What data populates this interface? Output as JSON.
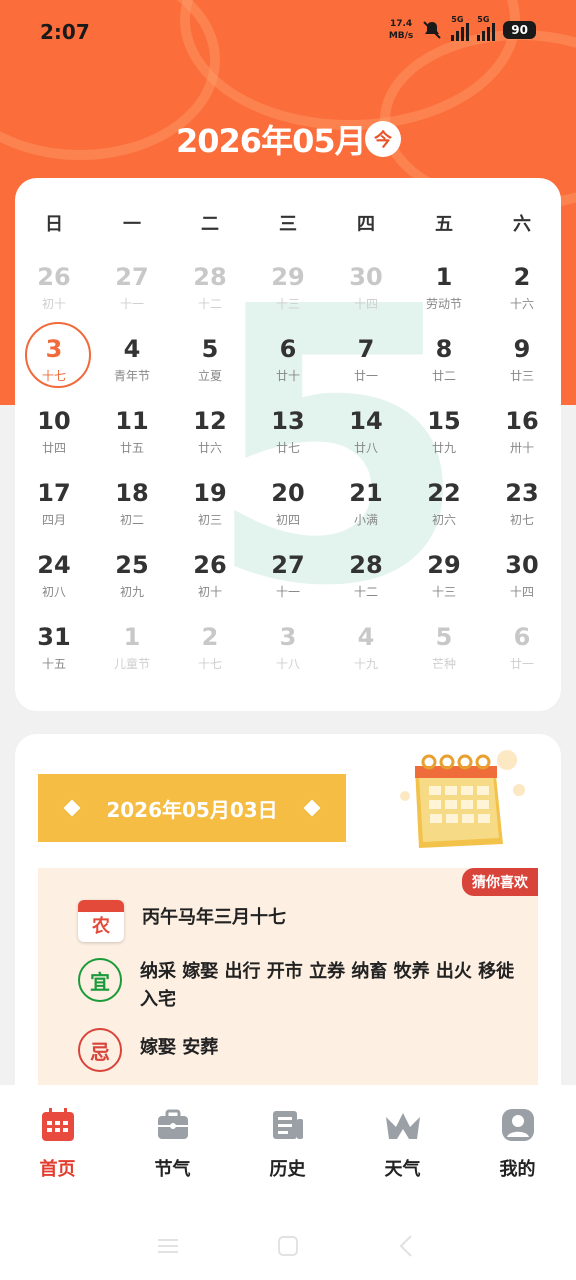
{
  "status": {
    "time": "2:07",
    "net_speed_value": "17.4",
    "net_speed_unit": "MB/s",
    "sim1": "5G",
    "sim2": "5G",
    "battery": "90"
  },
  "header": {
    "month_title": "2026年05月",
    "today_label": "今"
  },
  "calendar": {
    "big_number": "5",
    "weekdays": [
      "日",
      "一",
      "二",
      "三",
      "四",
      "五",
      "六"
    ],
    "rows": [
      [
        {
          "d": "26",
          "l": "初十",
          "other": true
        },
        {
          "d": "27",
          "l": "十一",
          "other": true
        },
        {
          "d": "28",
          "l": "十二",
          "other": true
        },
        {
          "d": "29",
          "l": "十三",
          "other": true
        },
        {
          "d": "30",
          "l": "十四",
          "other": true
        },
        {
          "d": "1",
          "l": "劳动节"
        },
        {
          "d": "2",
          "l": "十六"
        }
      ],
      [
        {
          "d": "3",
          "l": "十七",
          "today": true
        },
        {
          "d": "4",
          "l": "青年节"
        },
        {
          "d": "5",
          "l": "立夏"
        },
        {
          "d": "6",
          "l": "廿十"
        },
        {
          "d": "7",
          "l": "廿一"
        },
        {
          "d": "8",
          "l": "廿二"
        },
        {
          "d": "9",
          "l": "廿三"
        }
      ],
      [
        {
          "d": "10",
          "l": "廿四"
        },
        {
          "d": "11",
          "l": "廿五"
        },
        {
          "d": "12",
          "l": "廿六"
        },
        {
          "d": "13",
          "l": "廿七"
        },
        {
          "d": "14",
          "l": "廿八"
        },
        {
          "d": "15",
          "l": "廿九"
        },
        {
          "d": "16",
          "l": "卅十"
        }
      ],
      [
        {
          "d": "17",
          "l": "四月"
        },
        {
          "d": "18",
          "l": "初二"
        },
        {
          "d": "19",
          "l": "初三"
        },
        {
          "d": "20",
          "l": "初四"
        },
        {
          "d": "21",
          "l": "小满"
        },
        {
          "d": "22",
          "l": "初六"
        },
        {
          "d": "23",
          "l": "初七"
        }
      ],
      [
        {
          "d": "24",
          "l": "初八"
        },
        {
          "d": "25",
          "l": "初九"
        },
        {
          "d": "26",
          "l": "初十"
        },
        {
          "d": "27",
          "l": "十一"
        },
        {
          "d": "28",
          "l": "十二"
        },
        {
          "d": "29",
          "l": "十三"
        },
        {
          "d": "30",
          "l": "十四"
        }
      ],
      [
        {
          "d": "31",
          "l": "十五"
        },
        {
          "d": "1",
          "l": "儿童节",
          "other": true
        },
        {
          "d": "2",
          "l": "十七",
          "other": true
        },
        {
          "d": "3",
          "l": "十八",
          "other": true
        },
        {
          "d": "4",
          "l": "十九",
          "other": true
        },
        {
          "d": "5",
          "l": "芒种",
          "other": true
        },
        {
          "d": "6",
          "l": "廿一",
          "other": true
        }
      ]
    ]
  },
  "info": {
    "selected_date": "2026年05月03日",
    "like_badge": "猜你喜欢",
    "lunar_icon_char": "农",
    "lunar_date": "丙午马年三月十七",
    "yi_char": "宜",
    "yi_text": "纳采 嫁娶 出行 开市 立券 纳畜 牧养 出火 移徙 入宅",
    "ji_char": "忌",
    "ji_text": "嫁娶 安葬"
  },
  "tabs": [
    {
      "label": "首页",
      "icon": "calendar-icon",
      "active": true
    },
    {
      "label": "节气",
      "icon": "briefcase-icon"
    },
    {
      "label": "历史",
      "icon": "news-icon"
    },
    {
      "label": "天气",
      "icon": "crown-icon"
    },
    {
      "label": "我的",
      "icon": "user-icon"
    }
  ],
  "colors": {
    "accent": "#fb6d3a",
    "active_tab": "#e33b2e",
    "banner": "#f5bd43",
    "yi": "#1a9a3a",
    "ji": "#d9443a"
  }
}
